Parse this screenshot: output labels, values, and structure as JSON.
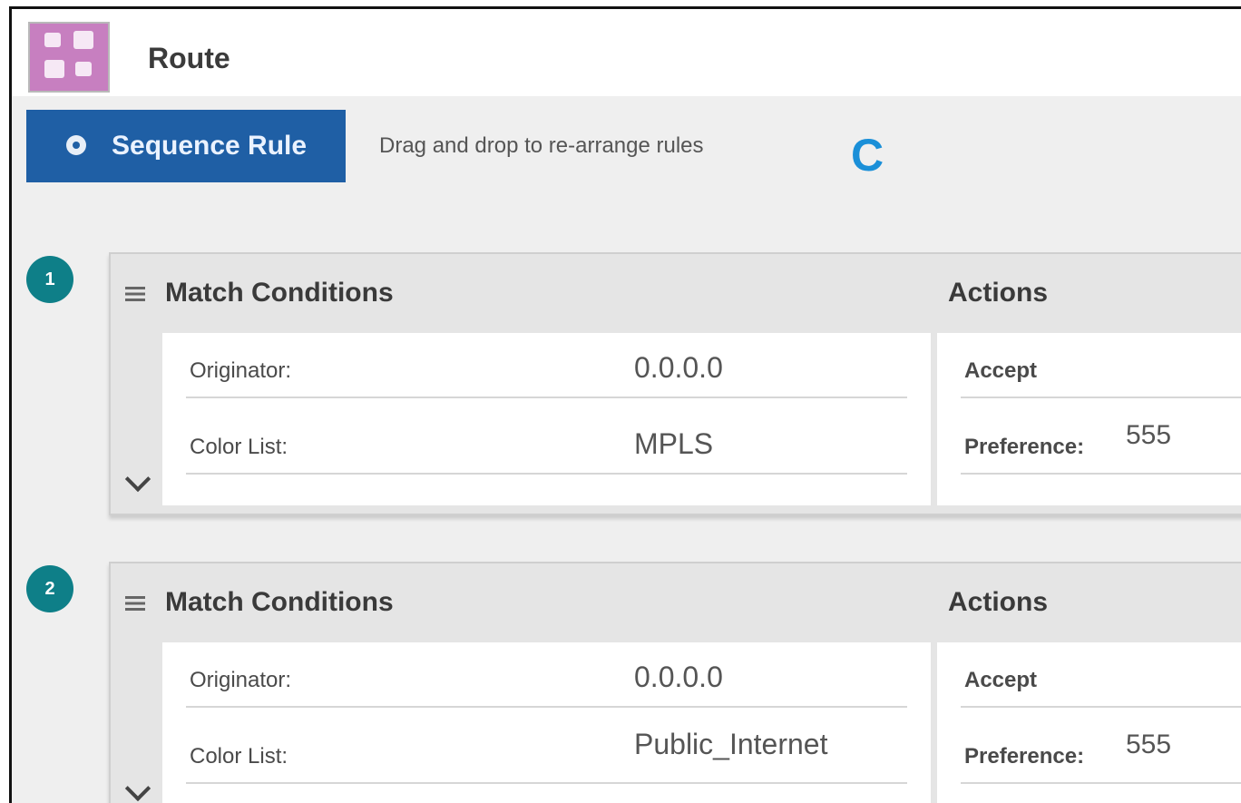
{
  "header": {
    "title": "Route",
    "logo_icon": "route-policy-icon"
  },
  "toolbar": {
    "sequence_rule_label": "Sequence Rule",
    "hint": "Drag and drop to re-arrange rules",
    "annotation": "C"
  },
  "colors": {
    "accent_button": "#1f5fa5",
    "badge": "#0e7f88",
    "annotation": "#1a8fd8"
  },
  "rules": [
    {
      "number": "1",
      "match_heading": "Match Conditions",
      "actions_heading": "Actions",
      "conditions": [
        {
          "label": "Originator:",
          "value": "0.0.0.0"
        },
        {
          "label": "Color List:",
          "value": "MPLS"
        }
      ],
      "actions": [
        {
          "label": "Accept",
          "value": ""
        },
        {
          "label": "Preference:",
          "value": "555"
        }
      ]
    },
    {
      "number": "2",
      "match_heading": "Match Conditions",
      "actions_heading": "Actions",
      "conditions": [
        {
          "label": "Originator:",
          "value": "0.0.0.0"
        },
        {
          "label": "Color List:",
          "value": "Public_Internet"
        }
      ],
      "actions": [
        {
          "label": "Accept",
          "value": ""
        },
        {
          "label": "Preference:",
          "value": "555"
        }
      ]
    }
  ]
}
